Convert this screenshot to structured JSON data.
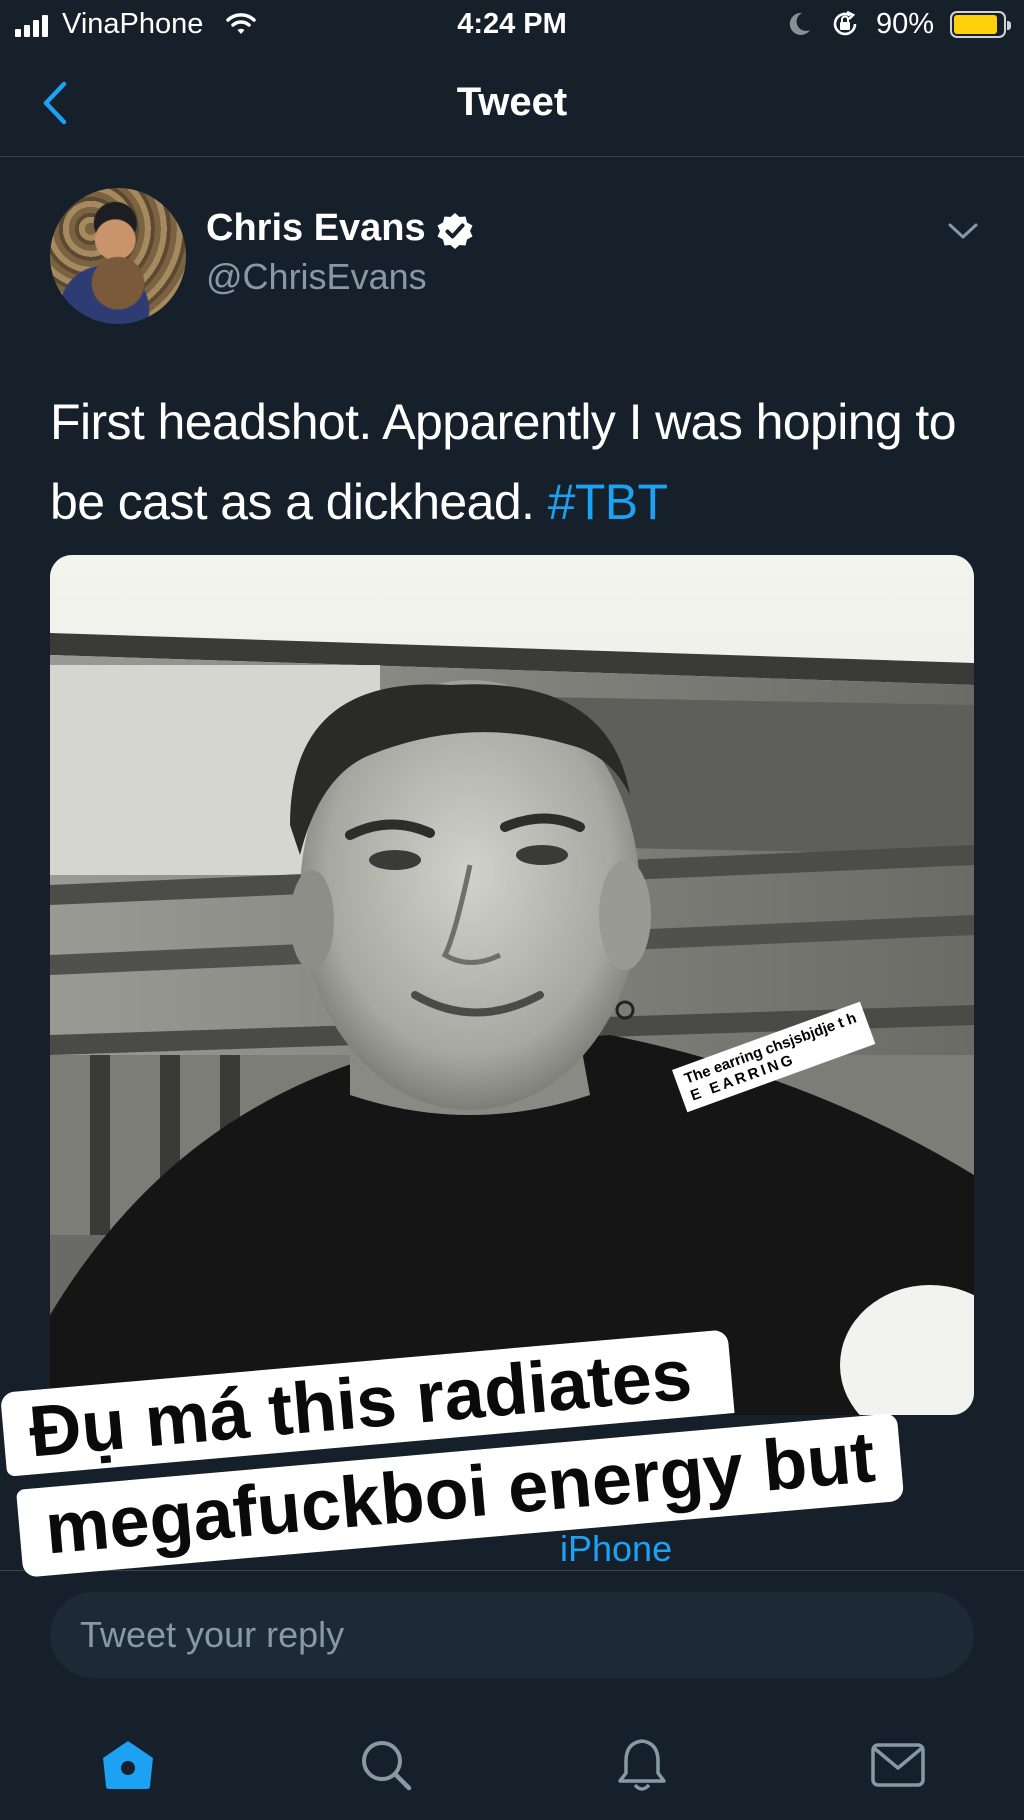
{
  "status_bar": {
    "carrier": "VinaPhone",
    "time": "4:24 PM",
    "battery": "90%",
    "battery_level": 0.9,
    "battery_color": "#ffcf0a",
    "icons": [
      "signal-icon",
      "wifi-icon",
      "moon-icon",
      "orientation-lock-icon",
      "battery-icon"
    ]
  },
  "nav": {
    "title": "Tweet",
    "back_icon": "chevron-left-icon"
  },
  "tweet": {
    "author_name": "Chris Evans",
    "author_handle": "@ChrisEvans",
    "verified": true,
    "text": "First headshot. Apparently I was hoping to be cast as a dickhead. ",
    "hashtag": "#TBT",
    "photo_sticker_line1": "The earring chsjsbjdje t h",
    "photo_sticker_line2": "E EARRING",
    "peek_link": "iPhone"
  },
  "caption_overlay": {
    "line1": "Đụ má this radiates",
    "line2": "megafuckboi energy but"
  },
  "reply": {
    "placeholder": "Tweet your reply"
  },
  "tab_bar": {
    "tabs": [
      "home-icon",
      "search-icon",
      "notifications-icon",
      "messages-icon"
    ],
    "active": "home-icon"
  },
  "colors": {
    "background": "#15202b",
    "accent": "#1da1f2",
    "secondary_text": "#8899a6",
    "divider": "#38444d"
  }
}
